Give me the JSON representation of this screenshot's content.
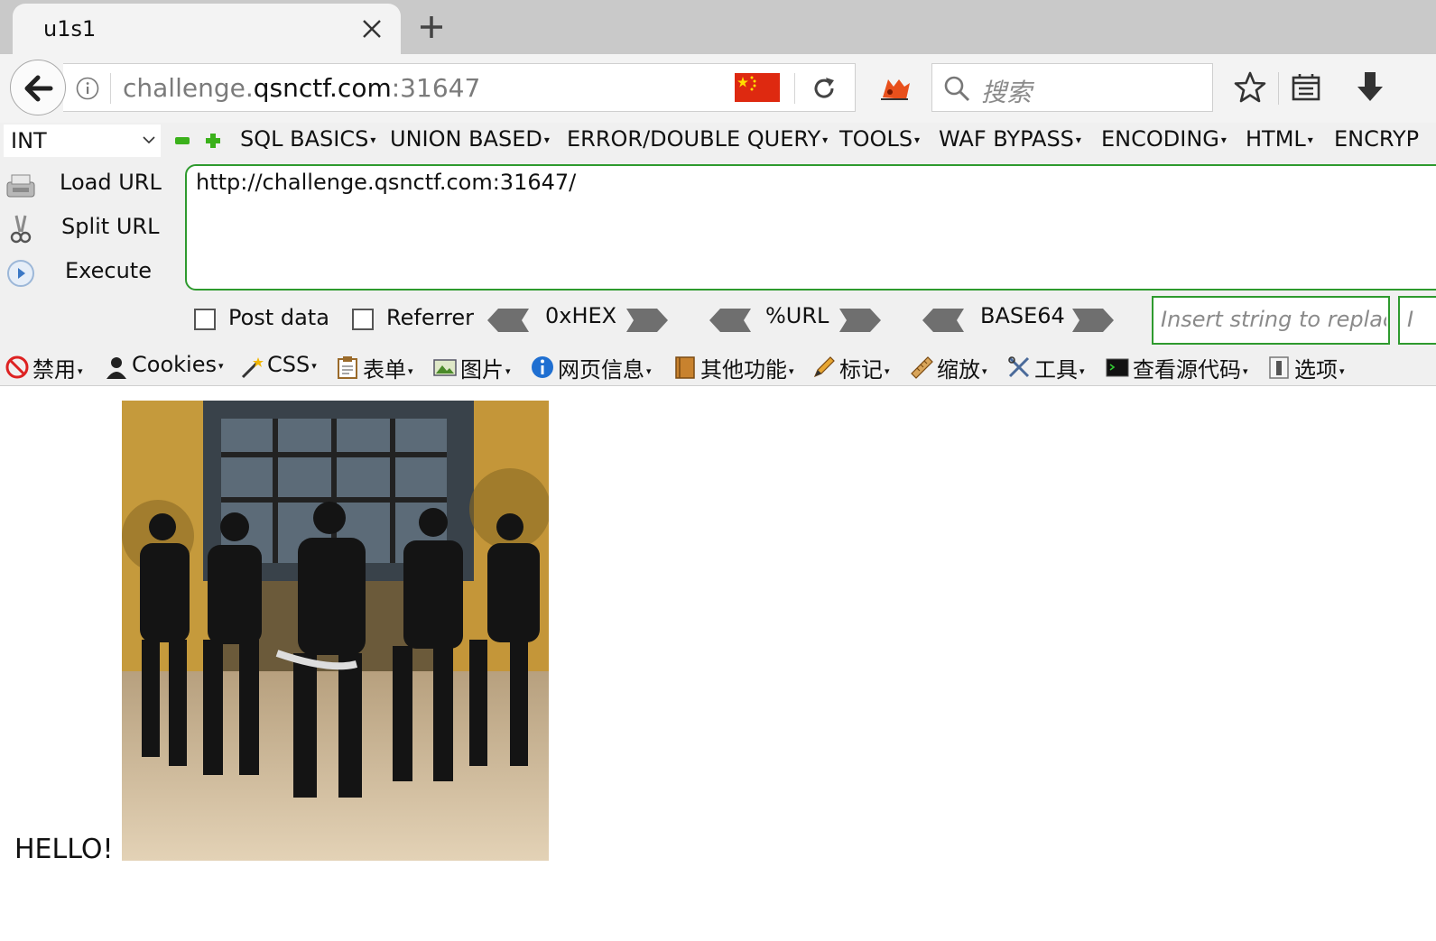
{
  "tab": {
    "title": "u1s1"
  },
  "navbar": {
    "url_host_prefix": "challenge.",
    "url_host_main": "qsnctf.com",
    "url_port": ":31647",
    "search_placeholder": "搜索"
  },
  "hackbar": {
    "int_select": "INT",
    "menus": [
      "SQL BASICS",
      "UNION BASED",
      "ERROR/DOUBLE QUERY",
      "TOOLS",
      "WAF BYPASS",
      "ENCODING",
      "HTML",
      "ENCRYP"
    ],
    "side": {
      "load": "Load URL",
      "split": "Split URL",
      "execute": "Execute"
    },
    "url_value": "http://challenge.qsnctf.com:31647/",
    "post_data": "Post data",
    "referrer": "Referrer",
    "hex": "0xHEX",
    "url_enc": "%URL",
    "base64": "BASE64",
    "replace_placeholder": "Insert string to replace",
    "replace_placeholder2": "I"
  },
  "devbar": {
    "items": [
      "禁用",
      "Cookies",
      "CSS",
      "表单",
      "图片",
      "网页信息",
      "其他功能",
      "标记",
      "缩放",
      "工具",
      "查看源代码",
      "选项"
    ]
  },
  "page": {
    "hello": "HELLO!"
  },
  "colors": {
    "hackbar_green": "#2e9a2e",
    "flag_red": "#de2910",
    "tab_strip": "#c9c9c9"
  }
}
